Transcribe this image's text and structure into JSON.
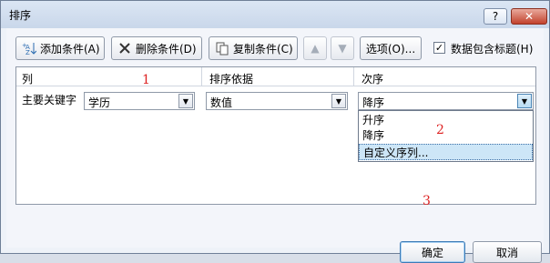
{
  "dialog": {
    "title": "排序",
    "help_label": "?",
    "close_label": "✕"
  },
  "toolbar": {
    "add_label": "添加条件(A)",
    "delete_label": "删除条件(D)",
    "copy_label": "复制条件(C)",
    "up_label": "▲",
    "down_label": "▼",
    "options_label": "选项(O)...",
    "header_checkbox_label": "数据包含标题(H)",
    "header_checkbox_checked": true
  },
  "grid": {
    "headers": {
      "column": "列",
      "sort_on": "排序依据",
      "order": "次序"
    },
    "row": {
      "label": "主要关键字",
      "key_value": "学历",
      "sort_on_value": "数值",
      "order_value": "降序"
    },
    "order_options": [
      "升序",
      "降序",
      "自定义序列..."
    ]
  },
  "annotations": [
    "1",
    "2",
    "3"
  ],
  "footer": {
    "ok_label": "确定",
    "cancel_label": "取消"
  }
}
